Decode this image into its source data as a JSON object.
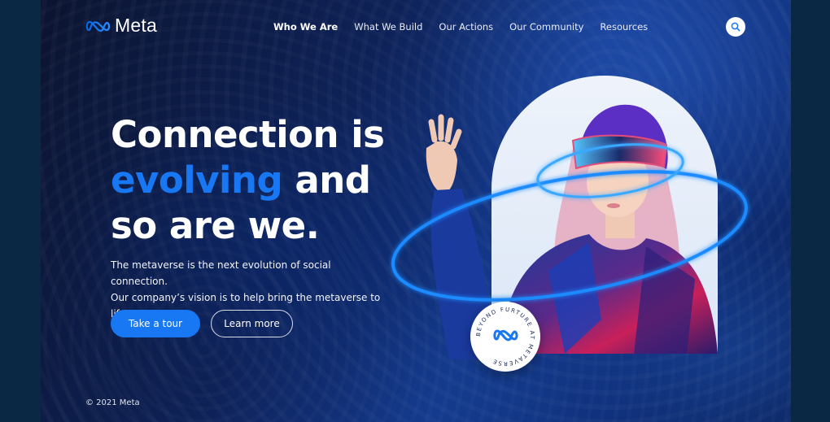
{
  "brand": {
    "name": "Meta",
    "logo_icon": "meta-infinity-icon",
    "color": "#1877f2"
  },
  "nav": {
    "items": [
      {
        "label": "Who We Are",
        "active": true
      },
      {
        "label": "What We Build",
        "active": false
      },
      {
        "label": "Our Actions",
        "active": false
      },
      {
        "label": "Our Community",
        "active": false
      },
      {
        "label": "Resources",
        "active": false
      }
    ],
    "search_icon": "search-icon"
  },
  "hero": {
    "headline_line1": "Connection is",
    "headline_accent": "evolving",
    "headline_line2_rest": " and",
    "headline_line3": "so are we.",
    "subtext_line1": "The metaverse is the next evolution of social connection.",
    "subtext_line2": "Our company’s vision is to help bring the metaverse to life.",
    "primary_button": "Take a tour",
    "secondary_button": "Learn more"
  },
  "badge": {
    "text": "BEYOND FURTURE AT METAVERSE",
    "icon": "meta-infinity-icon"
  },
  "footer": {
    "copyright": "© 2021 Meta"
  },
  "colors": {
    "accent": "#1877f2",
    "background": "#0e2258",
    "text": "#ffffff"
  }
}
